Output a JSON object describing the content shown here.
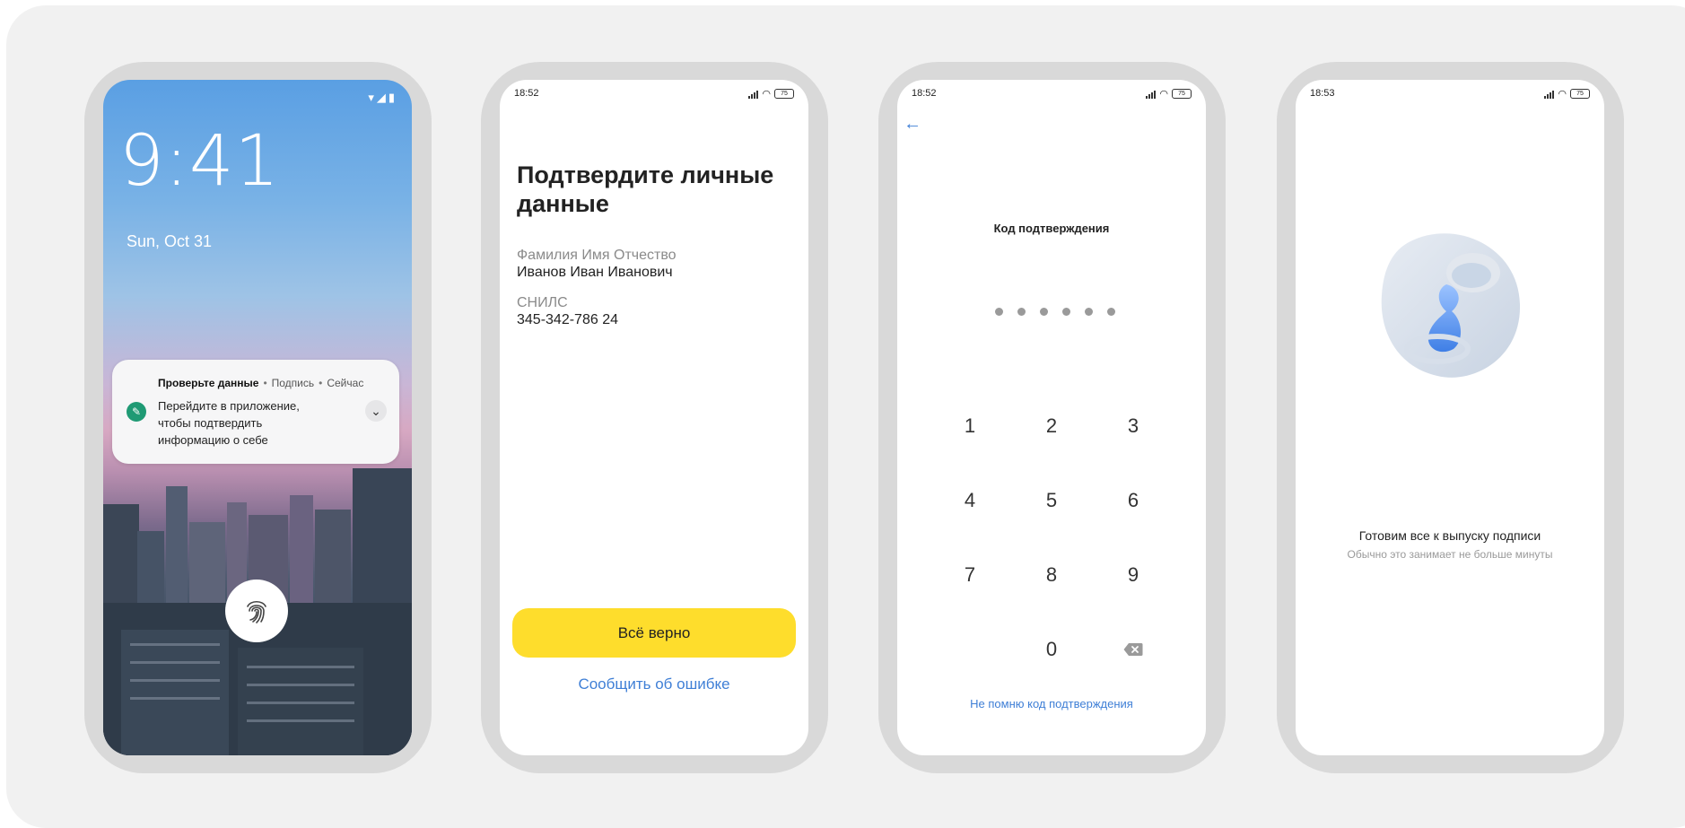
{
  "lock_screen": {
    "time": "9:41",
    "date": "Sun, Oct 31",
    "notification": {
      "title": "Проверьте данные",
      "app": "Подпись",
      "when": "Сейчас",
      "body": "Перейдите в приложение, чтобы подтвердить информацию о себе"
    }
  },
  "confirm_screen": {
    "status_time": "18:52",
    "battery": "75",
    "title": "Подтвердите личные данные",
    "fio_label": "Фамилия Имя Отчество",
    "fio_value": "Иванов Иван Иванович",
    "snils_label": "СНИЛС",
    "snils_value": "345-342-786 24",
    "confirm_button": "Всё верно",
    "report_link": "Сообщить об ошибке"
  },
  "code_screen": {
    "status_time": "18:52",
    "battery": "75",
    "title": "Код подтверждения",
    "pin_length": 6,
    "keys": [
      "1",
      "2",
      "3",
      "4",
      "5",
      "6",
      "7",
      "8",
      "9",
      "0"
    ],
    "forgot_link": "Не помню код подтверждения"
  },
  "waiting_screen": {
    "status_time": "18:53",
    "battery": "75",
    "title": "Готовим все к выпуску подписи",
    "subtitle": "Обычно это занимает не больше минуты"
  },
  "colors": {
    "accent_yellow": "#fedd2c",
    "link_blue": "#3f7fd6",
    "frame_gray": "#d9d9d9",
    "panel_gray": "#f1f1f1"
  }
}
